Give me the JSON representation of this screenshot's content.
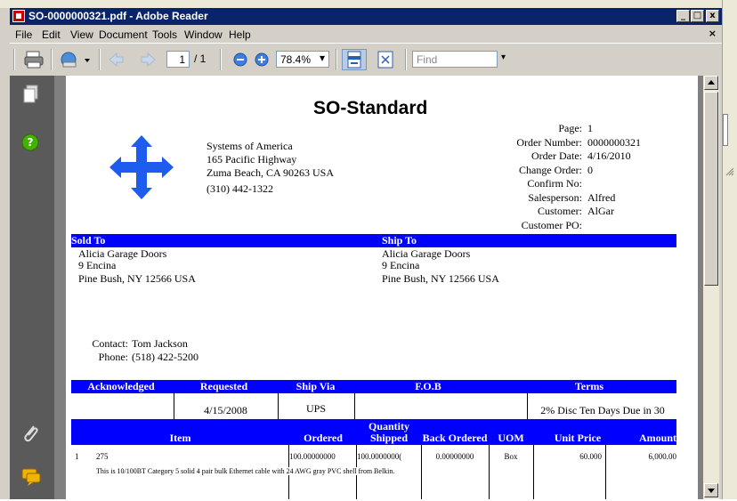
{
  "window": {
    "title": "SO-0000000321.pdf - Adobe Reader",
    "minimize_label": "_",
    "maximize_label": "□",
    "close_label": "x",
    "menu_close_label": "×"
  },
  "menu": {
    "items": [
      {
        "label": "File"
      },
      {
        "label": "Edit"
      },
      {
        "label": "View"
      },
      {
        "label": "Document"
      },
      {
        "label": "Tools"
      },
      {
        "label": "Window"
      },
      {
        "label": "Help"
      }
    ]
  },
  "toolbar": {
    "page_value": "1",
    "page_total": "/ 1",
    "zoom_value": "78.4%",
    "find_placeholder": "Find"
  },
  "document": {
    "title": "SO-Standard",
    "company": {
      "name": "Systems of America",
      "address1": "165 Pacific Highway",
      "address2": "Zuma Beach, CA  90263  USA",
      "phone": "(310) 442-1322"
    },
    "info": [
      {
        "label": "Page:",
        "value": "1"
      },
      {
        "label": "Order Number:",
        "value": "0000000321"
      },
      {
        "label": "Order Date:",
        "value": "4/16/2010"
      },
      {
        "label": "Change Order:",
        "value": "0"
      },
      {
        "label": "Confirm No:",
        "value": ""
      },
      {
        "label": "Salesperson:",
        "value": "Alfred"
      },
      {
        "label": "Customer:",
        "value": "AlGar"
      },
      {
        "label": "Customer PO:",
        "value": ""
      }
    ],
    "sold_to": {
      "header": "Sold To",
      "name": "Alicia Garage Doors",
      "address1": "9 Encina",
      "address2": "Pine Bush, NY  12566   USA"
    },
    "ship_to": {
      "header": "Ship To",
      "name": "Alicia Garage Doors",
      "address1": "9 Encina",
      "address2": "Pine Bush, NY  12566   USA"
    },
    "contact": {
      "contact_label": "Contact:",
      "contact_value": "Tom Jackson",
      "phone_label": "Phone:",
      "phone_value": "(518) 422-5200"
    },
    "order_headers": {
      "acknowledged": "Acknowledged",
      "requested": "Requested",
      "ship_via": "Ship Via",
      "fob": "F.O.B",
      "terms": "Terms"
    },
    "order_values": {
      "acknowledged": "",
      "requested": "4/15/2008",
      "ship_via": "UPS",
      "fob": "",
      "terms": "2% Disc Ten Days Due in 30"
    },
    "line_headers": {
      "item": "Item",
      "ordered": "Ordered",
      "quantity": "Quantity",
      "shipped": "Shipped",
      "back_ordered": "Back Ordered",
      "uom": "UOM",
      "unit_price": "Unit Price",
      "amount": "Amount"
    },
    "lines": [
      {
        "line_no": "1",
        "item": "275",
        "ordered": "100.00000000",
        "shipped": "100.0000000(",
        "back_ordered": "0.00000000",
        "uom": "Box",
        "unit_price": "60.000",
        "amount": "6,000.00",
        "description": "This is 10/100BT Category 5 solid 4 pair bulk Ethernet cable with 24 AWG gray PVC shell from Belkin."
      }
    ]
  },
  "colors": {
    "title_bar": "#0a246a",
    "doc_band": "#0000ff",
    "left_panel": "#5a5a5a",
    "help_icon": "#44b000",
    "comment_icon": "#f0b400",
    "logo": "#1e5cf0"
  }
}
